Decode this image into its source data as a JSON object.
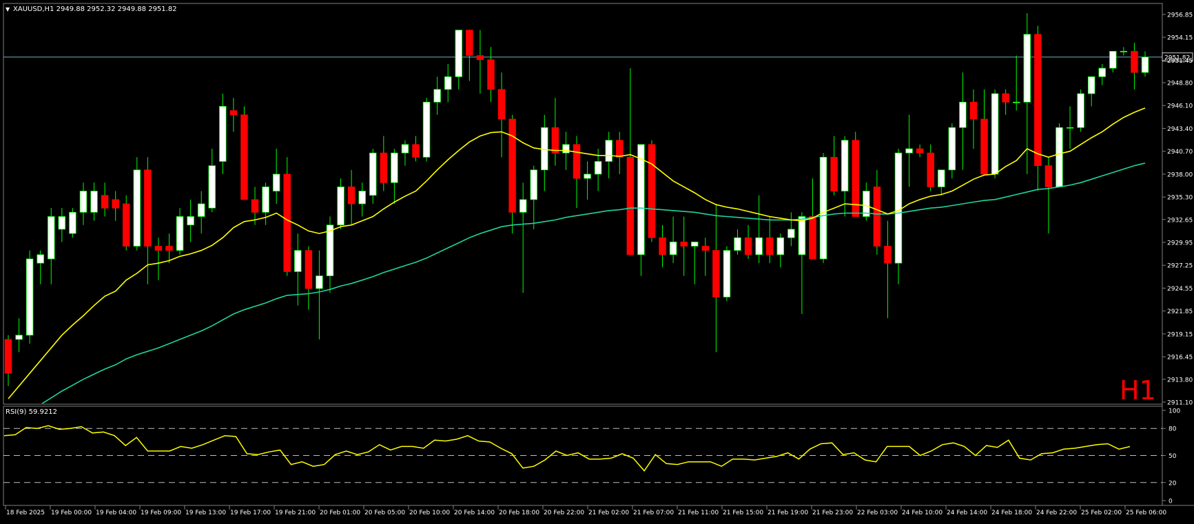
{
  "symbol_header": {
    "text": "XAUUSD,H1  2949.88 2952.32 2949.88 2951.82",
    "menu_icon": "triangle-down-icon"
  },
  "timeframe_watermark": "H1",
  "rsi_header": "RSI(9) 59.9212",
  "colors": {
    "background": "#000000",
    "bull_body": "#ffffff",
    "bull_outline": "#00ff00",
    "bear_body": "#ff0000",
    "wick": "#00ff00",
    "ma_fast": "#ffff00",
    "ma_slow": "#20d4a0",
    "rsi_line": "#ffff00",
    "bid_line": "#6fb0c8",
    "watermark": "#ff0000"
  },
  "chart_data": [
    {
      "type": "candlestick",
      "symbol": "XAUUSD",
      "timeframe": "H1",
      "ohlc": [
        2949.88,
        2952.32,
        2949.88,
        2951.82
      ],
      "current_price_label": "2951.82",
      "current_price": 2951.82,
      "ylim": [
        2911.1,
        2957.9
      ],
      "y_ticks": [
        "2956.85",
        "2954.15",
        "2951.45",
        "2948.80",
        "2946.10",
        "2943.40",
        "2940.70",
        "2938.00",
        "2935.30",
        "2932.65",
        "2929.95",
        "2927.25",
        "2924.55",
        "2921.85",
        "2919.15",
        "2916.45",
        "2913.80",
        "2911.10"
      ],
      "x_tick_labels": [
        "18 Feb 2025",
        "19 Feb 00:00",
        "19 Feb 04:00",
        "19 Feb 09:00",
        "19 Feb 13:00",
        "19 Feb 17:00",
        "19 Feb 21:00",
        "20 Feb 01:00",
        "20 Feb 05:00",
        "20 Feb 10:00",
        "20 Feb 14:00",
        "20 Feb 18:00",
        "20 Feb 22:00",
        "21 Feb 02:00",
        "21 Feb 07:00",
        "21 Feb 11:00",
        "21 Feb 15:00",
        "21 Feb 19:00",
        "21 Feb 23:00",
        "22 Feb 03:00",
        "24 Feb 10:00",
        "24 Feb 14:00",
        "24 Feb 18:00",
        "24 Feb 22:00",
        "25 Feb 02:00",
        "25 Feb 06:00"
      ],
      "candles": [
        [
          2918.5,
          2919.0,
          2913.0,
          2914.5
        ],
        [
          2918.5,
          2921.0,
          2917.0,
          2919.0
        ],
        [
          2919.0,
          2929.0,
          2918.0,
          2928.0
        ],
        [
          2927.5,
          2929.0,
          2925.0,
          2928.5
        ],
        [
          2928.0,
          2934.0,
          2925.0,
          2933.0
        ],
        [
          2931.5,
          2934.0,
          2930.0,
          2933.0
        ],
        [
          2931.0,
          2934.0,
          2930.5,
          2933.5
        ],
        [
          2933.5,
          2937.0,
          2932.0,
          2936.0
        ],
        [
          2933.5,
          2937.0,
          2932.5,
          2936.0
        ],
        [
          2935.5,
          2937.0,
          2933.0,
          2934.0
        ],
        [
          2935.0,
          2936.0,
          2932.5,
          2934.0
        ],
        [
          2934.5,
          2935.5,
          2929.0,
          2929.5
        ],
        [
          2929.5,
          2940.0,
          2929.0,
          2938.5
        ],
        [
          2938.5,
          2940.0,
          2925.0,
          2929.5
        ],
        [
          2929.5,
          2930.5,
          2925.5,
          2929.0
        ],
        [
          2929.5,
          2931.0,
          2927.5,
          2929.0
        ],
        [
          2929.0,
          2934.0,
          2928.5,
          2933.0
        ],
        [
          2932.0,
          2935.0,
          2930.0,
          2933.0
        ],
        [
          2933.0,
          2936.0,
          2931.0,
          2934.5
        ],
        [
          2934.0,
          2941.0,
          2933.5,
          2939.0
        ],
        [
          2939.5,
          2947.5,
          2938.0,
          2946.0
        ],
        [
          2945.5,
          2947.0,
          2943.0,
          2945.0
        ],
        [
          2945.0,
          2946.0,
          2935.0,
          2935.0
        ],
        [
          2935.0,
          2936.5,
          2932.0,
          2933.5
        ],
        [
          2933.5,
          2937.0,
          2932.0,
          2936.5
        ],
        [
          2936.0,
          2941.0,
          2934.5,
          2938.0
        ],
        [
          2938.0,
          2940.0,
          2926.0,
          2926.5
        ],
        [
          2926.5,
          2931.0,
          2922.5,
          2929.0
        ],
        [
          2929.0,
          2929.5,
          2922.0,
          2924.5
        ],
        [
          2924.5,
          2929.0,
          2918.5,
          2926.0
        ],
        [
          2926.0,
          2933.0,
          2924.0,
          2932.0
        ],
        [
          2932.0,
          2937.5,
          2931.5,
          2936.5
        ],
        [
          2936.5,
          2938.5,
          2932.0,
          2934.5
        ],
        [
          2934.5,
          2937.0,
          2933.0,
          2936.0
        ],
        [
          2935.5,
          2941.0,
          2934.5,
          2940.5
        ],
        [
          2940.5,
          2942.5,
          2936.0,
          2937.0
        ],
        [
          2937.0,
          2941.0,
          2934.5,
          2940.5
        ],
        [
          2940.5,
          2942.0,
          2939.0,
          2941.5
        ],
        [
          2941.5,
          2942.5,
          2939.5,
          2940.0
        ],
        [
          2940.0,
          2947.0,
          2939.5,
          2946.5
        ],
        [
          2946.5,
          2949.5,
          2945.0,
          2948.0
        ],
        [
          2948.0,
          2951.0,
          2946.5,
          2949.5
        ],
        [
          2949.5,
          2955.0,
          2948.0,
          2955.0
        ],
        [
          2955.0,
          2955.0,
          2949.0,
          2952.0
        ],
        [
          2952.0,
          2955.0,
          2947.5,
          2951.5
        ],
        [
          2951.5,
          2953.0,
          2946.5,
          2948.0
        ],
        [
          2948.0,
          2950.0,
          2940.0,
          2944.5
        ],
        [
          2944.5,
          2945.0,
          2931.0,
          2933.5
        ],
        [
          2933.5,
          2937.0,
          2924.0,
          2935.0
        ],
        [
          2935.0,
          2939.0,
          2931.5,
          2938.5
        ],
        [
          2938.5,
          2945.0,
          2936.0,
          2943.5
        ],
        [
          2943.5,
          2947.0,
          2939.0,
          2940.5
        ],
        [
          2940.5,
          2943.0,
          2938.5,
          2941.5
        ],
        [
          2941.5,
          2942.5,
          2934.0,
          2937.5
        ],
        [
          2937.5,
          2939.5,
          2935.0,
          2938.0
        ],
        [
          2938.0,
          2941.0,
          2936.0,
          2939.5
        ],
        [
          2939.5,
          2943.0,
          2937.5,
          2942.0
        ],
        [
          2942.0,
          2943.0,
          2938.0,
          2940.0
        ],
        [
          2940.0,
          2950.5,
          2929.0,
          2928.5
        ],
        [
          2928.5,
          2941.0,
          2926.0,
          2941.5
        ],
        [
          2941.5,
          2942.0,
          2930.0,
          2930.5
        ],
        [
          2930.5,
          2932.0,
          2927.0,
          2928.5
        ],
        [
          2928.5,
          2933.0,
          2927.5,
          2930.0
        ],
        [
          2930.0,
          2933.0,
          2926.0,
          2929.5
        ],
        [
          2929.5,
          2930.0,
          2925.0,
          2930.0
        ],
        [
          2929.5,
          2930.5,
          2926.0,
          2929.0
        ],
        [
          2929.0,
          2934.5,
          2917.0,
          2923.5
        ],
        [
          2923.5,
          2929.5,
          2923.0,
          2929.0
        ],
        [
          2929.0,
          2931.5,
          2928.5,
          2930.5
        ],
        [
          2930.5,
          2932.0,
          2928.0,
          2928.5
        ],
        [
          2928.5,
          2935.5,
          2927.5,
          2930.5
        ],
        [
          2930.5,
          2933.0,
          2927.5,
          2928.5
        ],
        [
          2928.5,
          2931.0,
          2927.0,
          2930.5
        ],
        [
          2930.5,
          2933.5,
          2929.5,
          2931.5
        ],
        [
          2928.5,
          2933.5,
          2921.5,
          2933.0
        ],
        [
          2933.0,
          2937.5,
          2928.0,
          2928.0
        ],
        [
          2928.0,
          2940.5,
          2927.5,
          2940.0
        ],
        [
          2940.0,
          2942.5,
          2935.5,
          2936.0
        ],
        [
          2936.0,
          2942.5,
          2933.0,
          2942.0
        ],
        [
          2942.0,
          2943.0,
          2933.0,
          2933.0
        ],
        [
          2933.0,
          2937.0,
          2932.5,
          2936.0
        ],
        [
          2936.5,
          2938.5,
          2928.5,
          2929.5
        ],
        [
          2929.5,
          2932.5,
          2921.0,
          2927.5
        ],
        [
          2927.5,
          2941.0,
          2925.0,
          2940.5
        ],
        [
          2940.5,
          2945.0,
          2936.5,
          2941.0
        ],
        [
          2941.0,
          2941.5,
          2940.0,
          2940.5
        ],
        [
          2940.5,
          2941.5,
          2936.0,
          2936.5
        ],
        [
          2936.5,
          2938.0,
          2935.5,
          2938.5
        ],
        [
          2938.5,
          2944.0,
          2937.5,
          2943.5
        ],
        [
          2943.5,
          2950.0,
          2938.5,
          2946.5
        ],
        [
          2946.5,
          2948.0,
          2941.0,
          2944.5
        ],
        [
          2944.5,
          2948.0,
          2938.0,
          2938.0
        ],
        [
          2938.0,
          2948.0,
          2937.5,
          2947.5
        ],
        [
          2947.5,
          2948.0,
          2945.0,
          2946.5
        ],
        [
          2946.5,
          2952.0,
          2945.5,
          2946.5
        ],
        [
          2946.5,
          2957.0,
          2938.0,
          2954.5
        ],
        [
          2954.5,
          2955.5,
          2936.0,
          2939.0
        ],
        [
          2939.0,
          2940.0,
          2931.0,
          2936.5
        ],
        [
          2936.5,
          2944.0,
          2936.5,
          2943.5
        ],
        [
          2943.5,
          2946.0,
          2941.0,
          2943.5
        ],
        [
          2943.5,
          2948.0,
          2943.0,
          2947.5
        ],
        [
          2947.5,
          2949.5,
          2946.0,
          2949.5
        ],
        [
          2949.5,
          2951.0,
          2948.5,
          2950.5
        ],
        [
          2950.5,
          2952.5,
          2950.0,
          2952.5
        ],
        [
          2952.5,
          2953.0,
          2952.0,
          2952.5
        ],
        [
          2952.5,
          2953.5,
          2948.0,
          2950.0
        ],
        [
          2950.0,
          2952.5,
          2949.5,
          2951.82
        ]
      ],
      "ma_fast": [
        2911.5,
        2913.0,
        2914.5,
        2916.0,
        2917.5,
        2919.0,
        2920.2,
        2921.3,
        2922.5,
        2923.6,
        2924.2,
        2925.5,
        2926.3,
        2927.3,
        2927.5,
        2927.8,
        2928.3,
        2928.6,
        2929.0,
        2929.6,
        2930.5,
        2931.7,
        2932.4,
        2932.6,
        2932.9,
        2933.4,
        2932.6,
        2932.0,
        2931.3,
        2931.0,
        2931.3,
        2931.8,
        2932.0,
        2932.5,
        2933.0,
        2933.9,
        2934.7,
        2935.4,
        2936.0,
        2937.2,
        2938.5,
        2939.7,
        2940.8,
        2941.8,
        2942.5,
        2942.9,
        2943.0,
        2942.5,
        2941.7,
        2941.1,
        2940.9,
        2940.8,
        2940.8,
        2940.6,
        2940.4,
        2940.2,
        2940.2,
        2940.1,
        2940.3,
        2939.8,
        2939.2,
        2938.2,
        2937.2,
        2936.5,
        2935.8,
        2935.0,
        2934.4,
        2934.1,
        2933.9,
        2933.6,
        2933.3,
        2933.0,
        2932.8,
        2932.6,
        2932.5,
        2932.8,
        2933.5,
        2934.0,
        2934.5,
        2934.4,
        2934.3,
        2933.8,
        2933.3,
        2933.7,
        2934.5,
        2935.0,
        2935.4,
        2935.6,
        2936.0,
        2936.7,
        2937.4,
        2937.9,
        2938.0,
        2938.9,
        2939.6,
        2941.0,
        2940.4,
        2940.0,
        2940.4,
        2940.7,
        2941.5,
        2942.3,
        2943.0,
        2943.9,
        2944.7,
        2945.3,
        2945.8
      ],
      "ma_slow": [
        2908.0,
        2909.0,
        2909.9,
        2910.8,
        2911.6,
        2912.4,
        2913.1,
        2913.8,
        2914.4,
        2915.0,
        2915.5,
        2916.2,
        2916.7,
        2917.1,
        2917.5,
        2918.0,
        2918.5,
        2919.0,
        2919.5,
        2920.1,
        2920.8,
        2921.5,
        2922.0,
        2922.4,
        2922.8,
        2923.3,
        2923.7,
        2923.8,
        2923.9,
        2924.1,
        2924.4,
        2924.8,
        2925.1,
        2925.5,
        2925.9,
        2926.4,
        2926.8,
        2927.2,
        2927.6,
        2928.1,
        2928.7,
        2929.3,
        2929.9,
        2930.5,
        2931.0,
        2931.4,
        2931.8,
        2932.0,
        2932.1,
        2932.2,
        2932.4,
        2932.6,
        2932.9,
        2933.1,
        2933.3,
        2933.5,
        2933.7,
        2933.8,
        2934.0,
        2934.0,
        2933.9,
        2933.8,
        2933.7,
        2933.6,
        2933.5,
        2933.3,
        2933.1,
        2933.0,
        2932.9,
        2932.8,
        2932.7,
        2932.6,
        2932.6,
        2932.6,
        2932.7,
        2932.9,
        2933.1,
        2933.3,
        2933.4,
        2933.4,
        2933.4,
        2933.3,
        2933.3,
        2933.4,
        2933.6,
        2933.8,
        2934.0,
        2934.1,
        2934.3,
        2934.5,
        2934.7,
        2934.9,
        2935.0,
        2935.3,
        2935.6,
        2935.9,
        2936.2,
        2936.3,
        2936.5,
        2936.7,
        2937.0,
        2937.4,
        2937.8,
        2938.2,
        2938.6,
        2939.0,
        2939.3
      ]
    },
    {
      "type": "line",
      "title": "RSI(9) 59.9212",
      "ylim": [
        0,
        100
      ],
      "y_ticks": [
        "100",
        "80",
        "50",
        "20",
        "0"
      ],
      "levels": [
        80,
        50,
        20
      ],
      "values": [
        72,
        73,
        81,
        80,
        83,
        79,
        80,
        82,
        75,
        76,
        72,
        61,
        70,
        55,
        55,
        55,
        60,
        58,
        62,
        67,
        72,
        71,
        52,
        51,
        54,
        56,
        40,
        43,
        38,
        40,
        51,
        55,
        51,
        54,
        62,
        56,
        60,
        60,
        58,
        67,
        66,
        68,
        72,
        66,
        65,
        58,
        52,
        36,
        38,
        45,
        55,
        50,
        53,
        46,
        46,
        47,
        52,
        47,
        33,
        51,
        41,
        40,
        43,
        43,
        43,
        38,
        46,
        46,
        45,
        47,
        49,
        53,
        46,
        57,
        63,
        64,
        51,
        53,
        45,
        43,
        60,
        60,
        60,
        50,
        55,
        62,
        64,
        60,
        50,
        61,
        59,
        67,
        47,
        45,
        52,
        53,
        57,
        58,
        60,
        62,
        63,
        57,
        59.9
      ]
    }
  ]
}
